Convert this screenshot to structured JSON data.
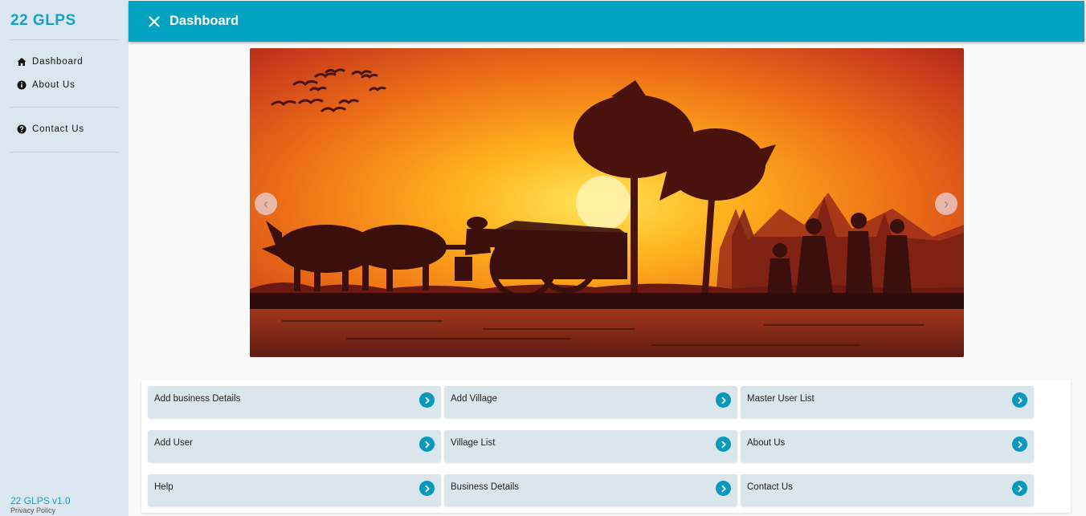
{
  "sidebar": {
    "brand": "22 GLPS",
    "items": [
      {
        "label": "Dashboard",
        "icon": "home-icon"
      },
      {
        "label": "About Us",
        "icon": "info-icon"
      },
      {
        "label": "Contact Us",
        "icon": "help-icon"
      }
    ],
    "version": "22 GLPS v1.0",
    "privacy": "Privacy Policy"
  },
  "header": {
    "title": "Dashboard",
    "close_icon": "close-icon",
    "color": "#02a2c2"
  },
  "carousel": {
    "prev_glyph": "‹",
    "next_glyph": "›"
  },
  "tiles": [
    {
      "label": "Add business Details"
    },
    {
      "label": "Add Village"
    },
    {
      "label": "Master User List"
    },
    {
      "label": "Add User"
    },
    {
      "label": "Village List"
    },
    {
      "label": "About Us"
    },
    {
      "label": "Help"
    },
    {
      "label": "Business Details"
    },
    {
      "label": "Contact Us"
    }
  ],
  "colors": {
    "accent": "#16a0c6",
    "sidebar_bg": "#dbe7ee",
    "tile_bg": "#dae6ec",
    "tile_arrow": "#0799bd"
  }
}
